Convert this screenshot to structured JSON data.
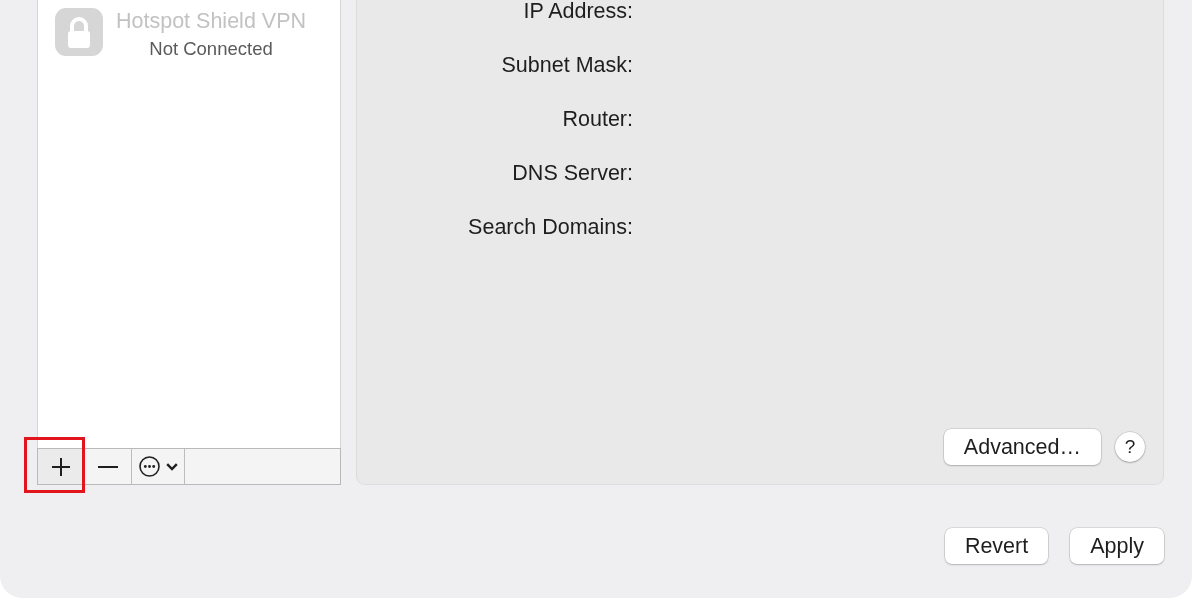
{
  "services": [
    {
      "name": "Hotspot Shield VPN",
      "status": "Not Connected",
      "selected": false,
      "disabled": true
    }
  ],
  "list_toolbar": [
    {
      "kind": "add",
      "highlighted": true
    },
    {
      "kind": "remove",
      "highlighted": false
    },
    {
      "kind": "action-menu",
      "highlighted": false
    }
  ],
  "details": {
    "fields": [
      {
        "label": "IP Address:"
      },
      {
        "label": "Subnet Mask:"
      },
      {
        "label": "Router:"
      },
      {
        "label": "DNS Server:"
      },
      {
        "label": "Search Domains:"
      }
    ],
    "buttons": [
      {
        "kind": "text",
        "label": "Advanced…"
      },
      {
        "kind": "help",
        "label": "?"
      }
    ]
  },
  "footer_buttons": [
    "Revert",
    "Apply"
  ]
}
